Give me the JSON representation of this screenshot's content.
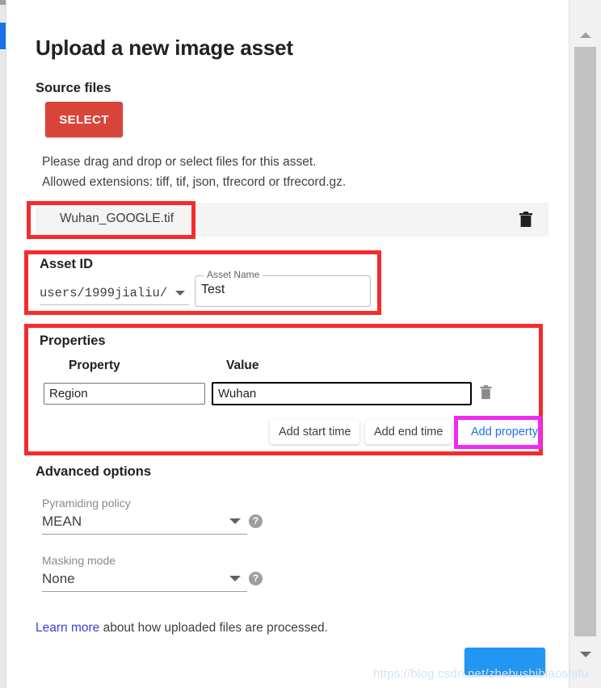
{
  "dialog": {
    "title": "Upload a new image asset"
  },
  "source_files": {
    "heading": "Source files",
    "select_button": "SELECT",
    "help_text": "Please drag and drop or select files for this asset.\nAllowed extensions: tiff, tif, json, tfrecord or tfrecord.gz.",
    "file": {
      "name": "Wuhan_GOOGLE.tif",
      "delete_icon": "trash-icon"
    }
  },
  "asset_id": {
    "heading": "Asset ID",
    "prefix": "users/1999jialiu/",
    "dropdown_icon": "chevron-down-icon",
    "name_field": {
      "label": "Asset Name",
      "value": "Test"
    }
  },
  "properties": {
    "heading": "Properties",
    "columns": [
      "Property",
      "Value"
    ],
    "rows": [
      {
        "property": "Region",
        "value": "Wuhan",
        "delete_icon": "trash-icon"
      }
    ],
    "buttons": {
      "add_start_time": "Add start time",
      "add_end_time": "Add end time",
      "add_property": "Add property"
    }
  },
  "advanced_options": {
    "heading": "Advanced options",
    "fields": [
      {
        "label": "Pyramiding policy",
        "value": "MEAN",
        "dropdown_icon": "chevron-down-icon",
        "help_icon": "help-circle-icon",
        "help_glyph": "?"
      },
      {
        "label": "Masking mode",
        "value": "None",
        "dropdown_icon": "chevron-down-icon",
        "help_icon": "help-circle-icon",
        "help_glyph": "?"
      }
    ]
  },
  "footer": {
    "learn_more_link": "Learn more",
    "learn_more_rest": " about how uploaded files are processed.",
    "upload_button": ""
  },
  "scrollbar": {
    "up_icon": "scroll-up-arrow-icon",
    "down_icon": "scroll-down-arrow-icon"
  },
  "annotations": {
    "red_color": "#f62b2b",
    "magenta_color": "#ef2bef"
  },
  "watermark": "https://blog.csdn.net/zhebushibiaoshifu"
}
